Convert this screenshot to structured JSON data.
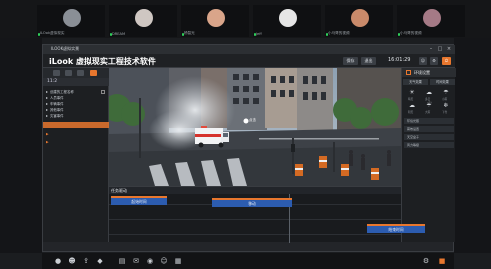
{
  "meeting": {
    "participants": [
      {
        "name": "ILOok虚拟现实",
        "avatar_color": "#8a8f96"
      },
      {
        "name": "DREAM",
        "avatar_color": "#cfc7c2"
      },
      {
        "name": "杨智光",
        "avatar_color": "#d9a58a"
      },
      {
        "name": "Jeff",
        "avatar_color": "#e6e6e6"
      },
      {
        "name": "小马哥的视频",
        "avatar_color": "#c98a6a"
      },
      {
        "name": "小马哥的视频",
        "avatar_color": "#a57a86"
      }
    ]
  },
  "app": {
    "window_title": "ILOOK虚拟实景",
    "brand": "iLook 虚拟现实工程技术软件",
    "time": "16:01:29",
    "top_buttons": [
      "保存",
      "退出"
    ],
    "accent_color": "#e8772e"
  },
  "left_panel": {
    "time": "11:2",
    "items": [
      "创建的工程名称",
      "人员事件",
      "车辆事件",
      "其他事件",
      "灾害事件"
    ]
  },
  "viewport": {
    "hint": "点击"
  },
  "right_panel": {
    "title": "环境设置",
    "tabs": [
      "天气效果",
      "时间效果"
    ],
    "weather": [
      {
        "icon": "☀",
        "label": "晴天"
      },
      {
        "icon": "☁",
        "label": "多云"
      },
      {
        "icon": "☂",
        "label": "小雨"
      },
      {
        "icon": "☁",
        "label": "阴天"
      },
      {
        "icon": "☔",
        "label": "大雨"
      },
      {
        "icon": "❄",
        "label": "下雪"
      }
    ],
    "rows": [
      "环境光照",
      "雾效设置",
      "天空盒子",
      "风力等级"
    ]
  },
  "timeline": {
    "title": "任务驱动",
    "clips": [
      "起始时间",
      "移动",
      "结束时间"
    ]
  },
  "bottom_bar": {
    "icons": [
      "mic-icon",
      "participants-icon",
      "share-icon",
      "security-icon",
      "layout-icon",
      "chat-icon",
      "record-icon",
      "smile-icon",
      "apps-icon",
      "settings-icon",
      "end-icon"
    ]
  }
}
